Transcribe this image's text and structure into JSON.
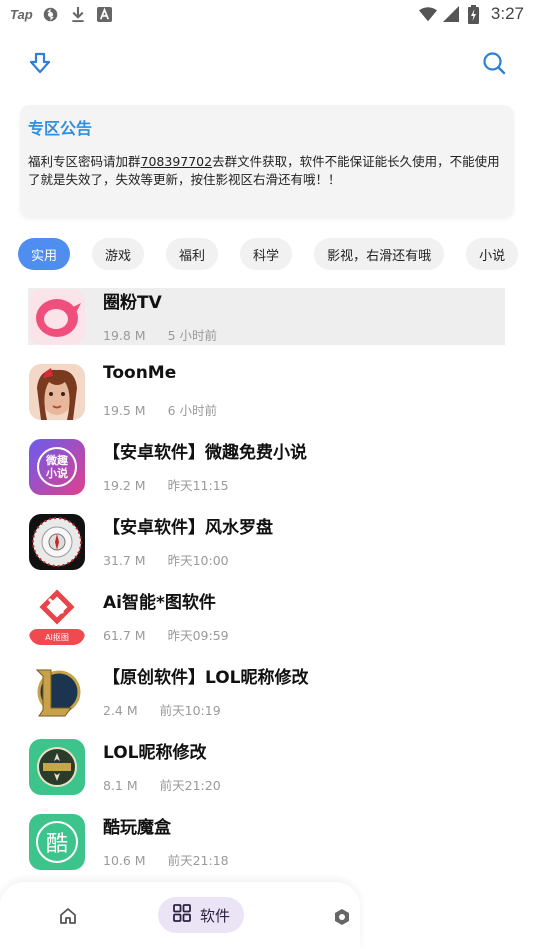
{
  "status_bar": {
    "tap_label": "Tap",
    "time": "3:27"
  },
  "notice": {
    "title": "专区公告",
    "body_prefix": "福利专区密码请加群",
    "group_number": "708397702",
    "body_suffix": "去群文件获取，软件不能保证能长久使用，不能使用了就是失效了，失效等更新，按住影视区右滑还有哦！！"
  },
  "categories": [
    {
      "label": "实用",
      "active": true
    },
    {
      "label": "游戏",
      "active": false
    },
    {
      "label": "福利",
      "active": false
    },
    {
      "label": "科学",
      "active": false
    },
    {
      "label": "影视，右滑还有哦",
      "active": false
    },
    {
      "label": "小说",
      "active": false
    }
  ],
  "apps": [
    {
      "name": "圈粉TV",
      "size": "19.8 M",
      "time": "5 小时前",
      "icon": "quanfen-tv-app-icon"
    },
    {
      "name": "ToonMe",
      "size": "19.5 M",
      "time": "6 小时前",
      "icon": "toonme-app-icon"
    },
    {
      "name": "【安卓软件】微趣免费小说",
      "size": "19.2 M",
      "time": "昨天11:15",
      "icon": "weiqu-novel-app-icon",
      "icon_text_1": "微趣",
      "icon_text_2": "小说"
    },
    {
      "name": "【安卓软件】风水罗盘",
      "size": "31.7 M",
      "time": "昨天10:00",
      "icon": "fengshui-compass-app-icon"
    },
    {
      "name": "Ai智能*图软件",
      "size": "61.7 M",
      "time": "昨天09:59",
      "icon": "ai-image-app-icon",
      "icon_text_1": "AI抠图"
    },
    {
      "name": "【原创软件】LOL昵称修改",
      "size": "2.4 M",
      "time": "前天10:19",
      "icon": "lol-logo-app-icon"
    },
    {
      "name": "LOL昵称修改",
      "size": "8.1 M",
      "time": "前天21:20",
      "icon": "lol-nickname-app-icon"
    },
    {
      "name": "酷玩魔盒",
      "size": "10.6 M",
      "time": "前天21:18",
      "icon": "kuwan-mohe-app-icon",
      "icon_text_1": "酷"
    }
  ],
  "bottom_nav": {
    "software_label": "软件"
  },
  "colors": {
    "accent": "#2f8fe0",
    "chip_active": "#4f8ef0",
    "nav_active_bg": "#ebe4f6"
  }
}
